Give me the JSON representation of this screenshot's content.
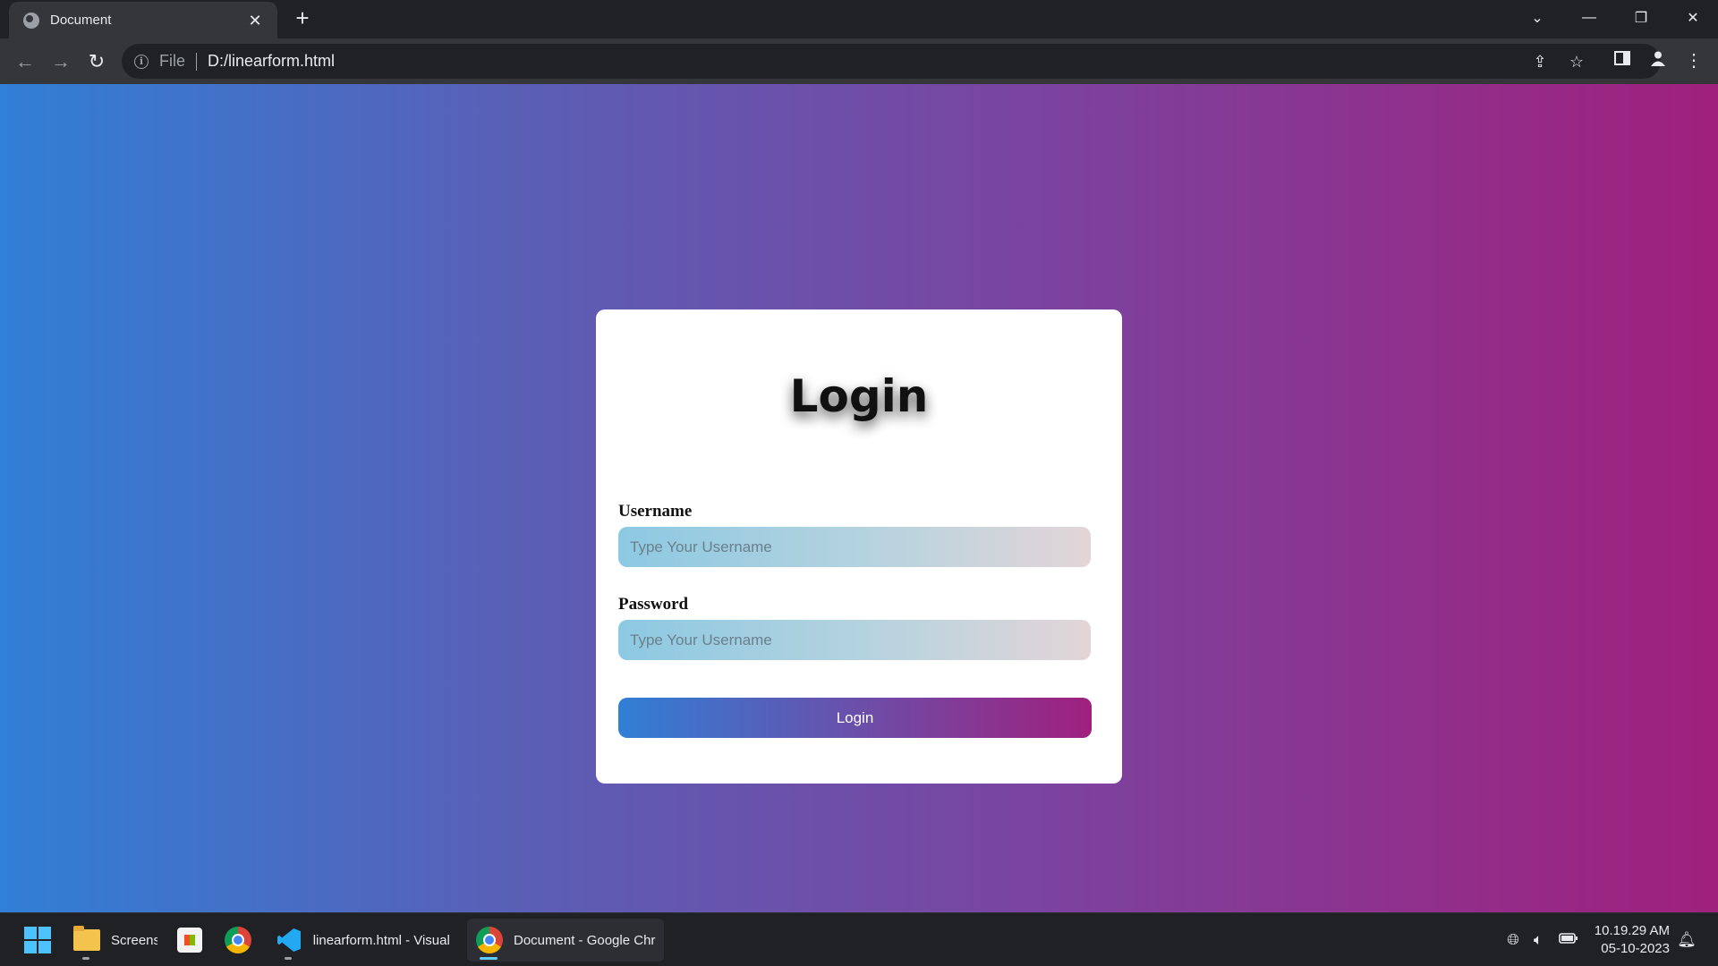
{
  "browser": {
    "tab": {
      "title": "Document",
      "close": "✕"
    },
    "new_tab": "+",
    "window_controls": [
      "⌄",
      "—",
      "❐",
      "✕"
    ],
    "nav": {
      "back": "←",
      "forward": "→",
      "reload": "↻"
    },
    "address": {
      "scheme": "File",
      "url": "D:/linearform.html"
    },
    "icons": [
      "share-icon",
      "bookmark-star-icon",
      "side-panel-icon",
      "profile-icon",
      "menu-icon"
    ]
  },
  "page": {
    "title": "Login",
    "username": {
      "label": "Username",
      "placeholder": "Type Your Username"
    },
    "password": {
      "label": "Password",
      "placeholder": "Type Your Username"
    },
    "button": "Login",
    "colors": {
      "gradient_start": "#317fd6",
      "gradient_end": "#a0207d"
    }
  },
  "taskbar": {
    "apps": [
      {
        "label": "Screens"
      },
      {
        "label": "linearform.html - Visual"
      },
      {
        "label": "Document - Google Chr"
      }
    ],
    "clock": {
      "time": "10.19.29 AM",
      "date": "05-10-2023"
    }
  }
}
